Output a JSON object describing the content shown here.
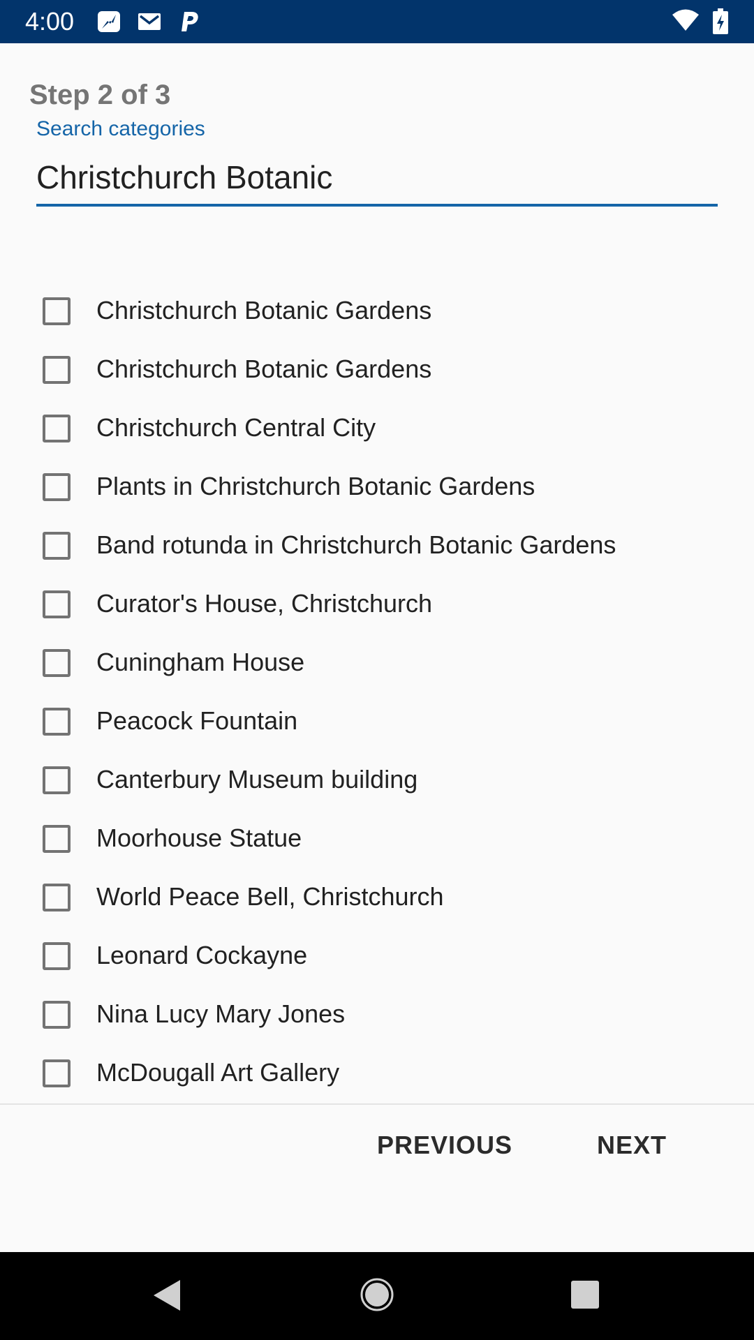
{
  "status_bar": {
    "time": "4:00",
    "notification_icons": [
      "zap-icon",
      "gmail-icon",
      "paypal-icon"
    ],
    "system_icons": [
      "wifi-icon",
      "battery-charging-icon"
    ]
  },
  "header": {
    "step": "Step 2 of 3"
  },
  "search": {
    "label": "Search categories",
    "value": "Christchurch Botanic"
  },
  "categories": [
    {
      "label": "Christchurch Botanic Gardens",
      "checked": false
    },
    {
      "label": "Christchurch Botanic Gardens",
      "checked": false
    },
    {
      "label": "Christchurch Central City",
      "checked": false
    },
    {
      "label": "Plants in Christchurch Botanic Gardens",
      "checked": false
    },
    {
      "label": "Band rotunda in Christchurch Botanic Gardens",
      "checked": false
    },
    {
      "label": "Curator's House, Christchurch",
      "checked": false
    },
    {
      "label": "Cuningham House",
      "checked": false
    },
    {
      "label": "Peacock Fountain",
      "checked": false
    },
    {
      "label": "Canterbury Museum building",
      "checked": false
    },
    {
      "label": "Moorhouse Statue",
      "checked": false
    },
    {
      "label": "World Peace Bell, Christchurch",
      "checked": false
    },
    {
      "label": "Leonard Cockayne",
      "checked": false
    },
    {
      "label": "Nina Lucy Mary Jones",
      "checked": false
    },
    {
      "label": "McDougall Art Gallery",
      "checked": false
    }
  ],
  "footer": {
    "previous_label": "PREVIOUS",
    "next_label": "NEXT"
  },
  "nav_bar": {
    "icons": [
      "back-icon",
      "home-icon",
      "recents-icon"
    ]
  },
  "colors": {
    "status_bar": "#02346b",
    "accent": "#1565a8",
    "background": "#fafafa",
    "nav_bar": "#000000"
  }
}
